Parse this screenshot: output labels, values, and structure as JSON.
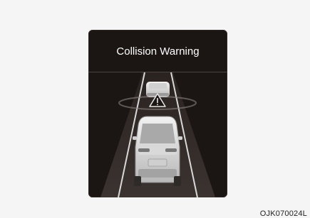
{
  "display": {
    "title": "Collision Warning",
    "warning_icon": "warning-triangle-icon",
    "lead_vehicle_icon": "lead-vehicle-icon",
    "own_vehicle_icon": "own-vehicle-icon"
  },
  "figure": {
    "code": "OJK070024L"
  },
  "colors": {
    "panel_background": "#1b1614",
    "title_text": "#ffffff",
    "page_background": "#f5f5f5"
  }
}
